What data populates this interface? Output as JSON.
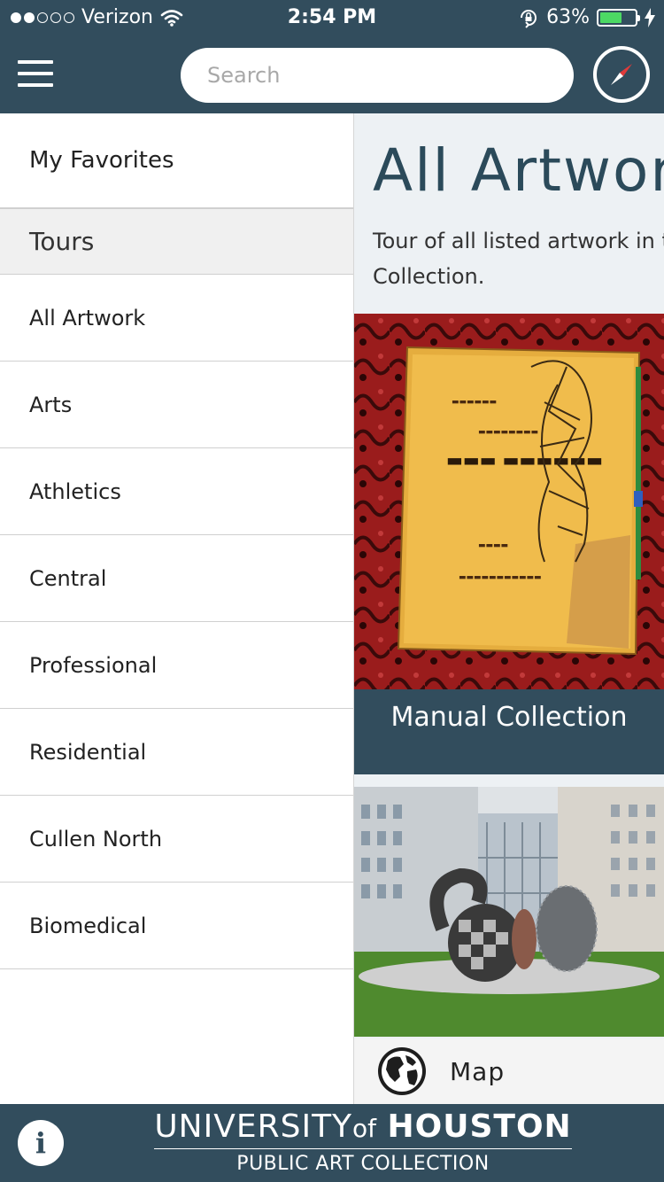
{
  "status_bar": {
    "carrier": "Verizon",
    "time": "2:54 PM",
    "battery_percent": "63%",
    "battery_level": 0.63,
    "signal_bars_filled": 2,
    "signal_bars_total": 5,
    "icons": [
      "wifi-icon",
      "orientation-lock-icon",
      "battery-icon",
      "charging-icon"
    ]
  },
  "nav_bar": {
    "search_placeholder": "Search",
    "left_icon": "hamburger-menu-icon",
    "right_icon": "compass-icon"
  },
  "drawer": {
    "favorites_label": "My Favorites",
    "tours_header": "Tours",
    "tours": [
      {
        "label": "All Artwork"
      },
      {
        "label": "Arts"
      },
      {
        "label": "Athletics"
      },
      {
        "label": "Central"
      },
      {
        "label": "Professional"
      },
      {
        "label": "Residential"
      },
      {
        "label": "Cullen North"
      },
      {
        "label": "Biomedical"
      }
    ]
  },
  "content": {
    "title": "All Artwork",
    "description": "Tour of all listed artwork in the Collection.",
    "cards": [
      {
        "label": "Manual Collection"
      }
    ],
    "map_label": "Map",
    "map_icon": "globe-icon"
  },
  "footer": {
    "logo_university": "UNIVERSITY",
    "logo_of": "of",
    "logo_houston": "HOUSTON",
    "logo_subtitle": "PUBLIC ART COLLECTION",
    "info_icon_label": "i"
  },
  "colors": {
    "brand": "#324d5d",
    "battery_green": "#4cd964",
    "content_bg": "#edf1f4",
    "title_color": "#2b4a5a"
  }
}
